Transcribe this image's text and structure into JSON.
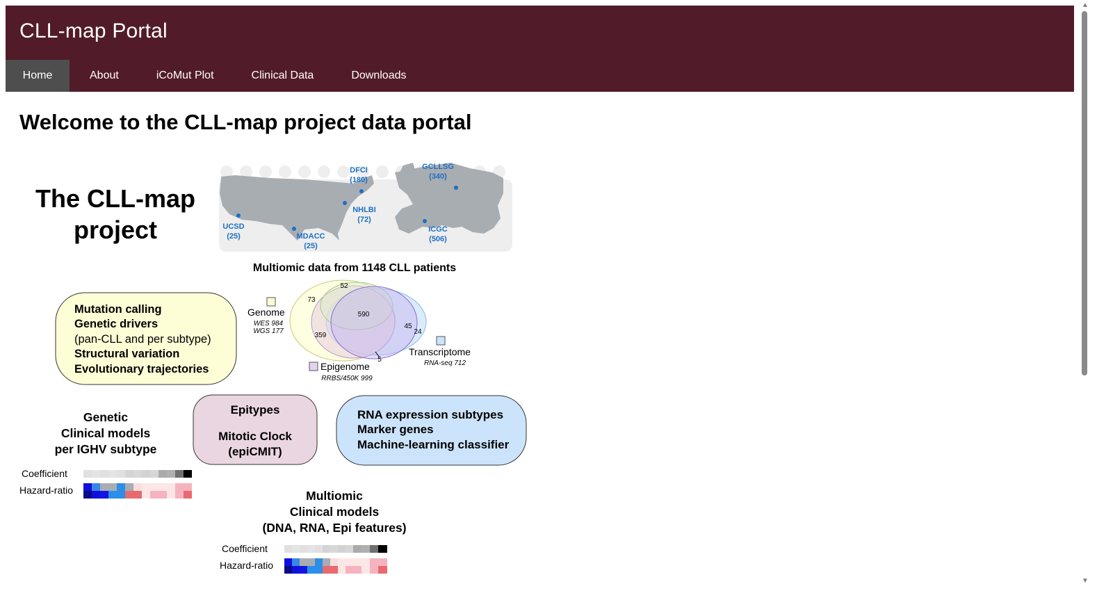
{
  "portal_title": "CLL-map Portal",
  "nav": [
    {
      "label": "Home",
      "active": true
    },
    {
      "label": "About"
    },
    {
      "label": "iCoMut Plot"
    },
    {
      "label": "Clinical Data"
    },
    {
      "label": "Downloads"
    }
  ],
  "welcome_title": "Welcome to the CLL-map project data portal",
  "figure": {
    "project_title_line1": "The CLL-map",
    "project_title_line2": "project",
    "sites": [
      {
        "name": "UCSD",
        "count": "(25)"
      },
      {
        "name": "MDACC",
        "count": "(25)"
      },
      {
        "name": "DFCI",
        "count": "(180)"
      },
      {
        "name": "NHLBI",
        "count": "(72)"
      },
      {
        "name": "GCLLSG",
        "count": "(340)"
      },
      {
        "name": "ICGC",
        "count": "(506)"
      }
    ],
    "multiomic_caption": "Multiomic data from 1148 CLL patients",
    "venn": {
      "genome_label": "Genome",
      "genome_sub1": "WES 984",
      "genome_sub2": "WGS 177",
      "epigenome_label": "Epigenome",
      "epigenome_sub": "RRBS/450K 999",
      "transcriptome_label": "Transcriptome",
      "transcriptome_sub": "RNA-seq 712",
      "n52": "52",
      "n73": "73",
      "n590": "590",
      "n359": "359",
      "n45": "45",
      "n24": "24",
      "n5": "5"
    },
    "genome_box": {
      "line1": "Mutation calling",
      "line2": "Genetic drivers",
      "line3": "(pan-CLL and per subtype)",
      "line4": "Structural variation",
      "line5": "Evolutionary trajectories"
    },
    "genetic_models": {
      "line1": "Genetic",
      "line2": "Clinical models",
      "line3": "per IGHV subtype",
      "coef_label": "Coefficient",
      "hr_label": "Hazard-ratio"
    },
    "epi_box": {
      "line1": "Epitypes",
      "line2": "Mitotic Clock",
      "line3": "(epiCMIT)"
    },
    "rna_box": {
      "line1": "RNA expression subtypes",
      "line2": "Marker genes",
      "line3": "Machine-learning classifier"
    },
    "multiomic_models": {
      "line1": "Multiomic",
      "line2": "Clinical models",
      "line3": "(DNA, RNA, Epi features)",
      "coef_label": "Coefficient",
      "hr_label": "Hazard-ratio"
    },
    "colors": {
      "genome": "#fdfdd6",
      "epigenome": "#ead6e0",
      "transcriptome": "#cce4fb",
      "site_blue": "#1d6fc4",
      "map_gray": "#a8adb2"
    }
  }
}
